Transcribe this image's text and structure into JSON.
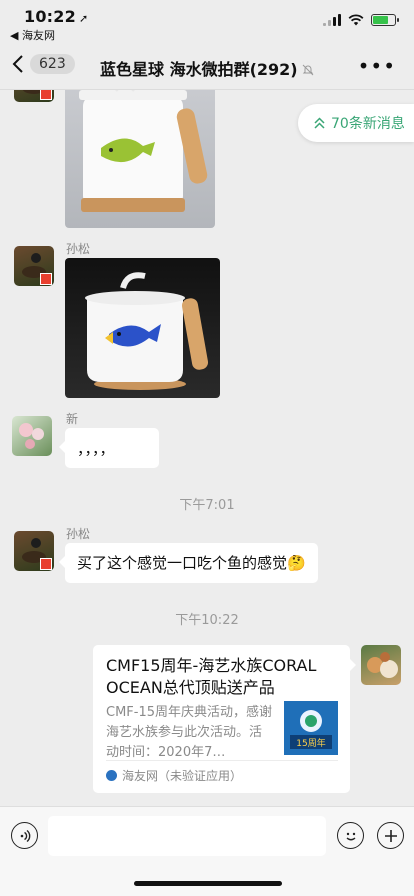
{
  "status_bar": {
    "time": "10:22",
    "back_app": "◀ 海友网"
  },
  "nav": {
    "unread_count": "623",
    "title": "蓝色星球 海水微拍群(292)"
  },
  "new_messages_label": "70条新消息",
  "messages": {
    "sender_1": "孙松",
    "sender_2": "新",
    "sender_2_text": "，，，，",
    "timestamp_1": "下午7:01",
    "sender_3": "孙松",
    "sender_3_text": "买了这个感觉一口吃个鱼的感觉🤔",
    "timestamp_2": "下午10:22"
  },
  "link_card": {
    "title": "CMF15周年-海艺水族CORAL OCEAN总代顶贴送产品",
    "description": "CMF-15周年庆典活动，感谢海艺水族参与此次活动。活动时间：2020年7…",
    "source": "海友网（未验证应用）",
    "thumb_text": "15周年"
  },
  "colors": {
    "accent_green": "#3aa676",
    "battery_green": "#36c24a",
    "flag_red": "#e8402f"
  }
}
